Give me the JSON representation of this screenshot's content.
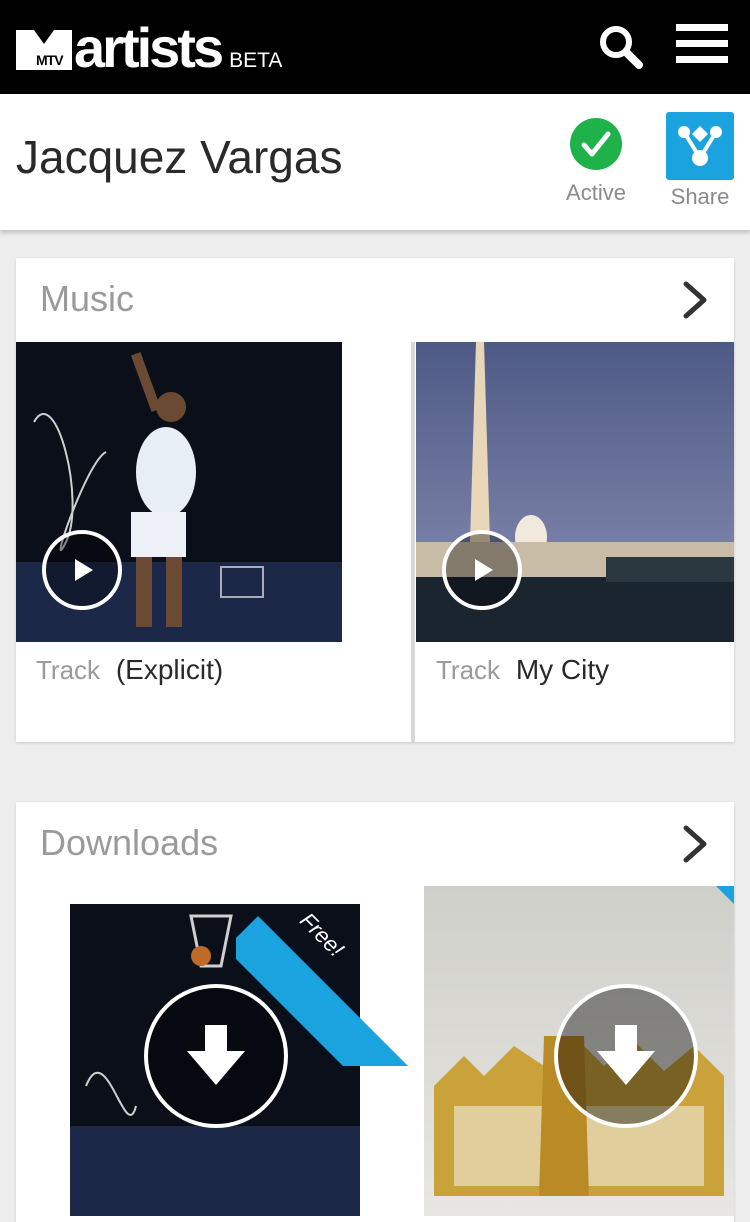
{
  "header": {
    "logo_word": "artists",
    "logo_tv": "MTV",
    "beta_label": "BETA",
    "search_icon": "search-icon",
    "menu_icon": "hamburger-menu-icon"
  },
  "artist": {
    "name": "Jacquez Vargas",
    "status_label": "Active",
    "status_icon": "checkmark-icon",
    "status_color": "#1fb24a",
    "share_label": "Share",
    "share_icon": "share-icon",
    "share_color": "#1aa3de"
  },
  "music": {
    "title": "Music",
    "chevron_icon": "chevron-right-icon",
    "tracks": [
      {
        "kind": "Track",
        "name": "(Explicit)",
        "image": "basketball-dunk-photo"
      },
      {
        "kind": "Track",
        "name": "My City",
        "image": "washington-monument-photo"
      }
    ]
  },
  "downloads": {
    "title": "Downloads",
    "chevron_icon": "chevron-right-icon",
    "items": [
      {
        "image": "basketball-dunk-photo",
        "badge": "Free!"
      },
      {
        "image": "gold-jewelry-photo",
        "badge": ""
      }
    ]
  }
}
